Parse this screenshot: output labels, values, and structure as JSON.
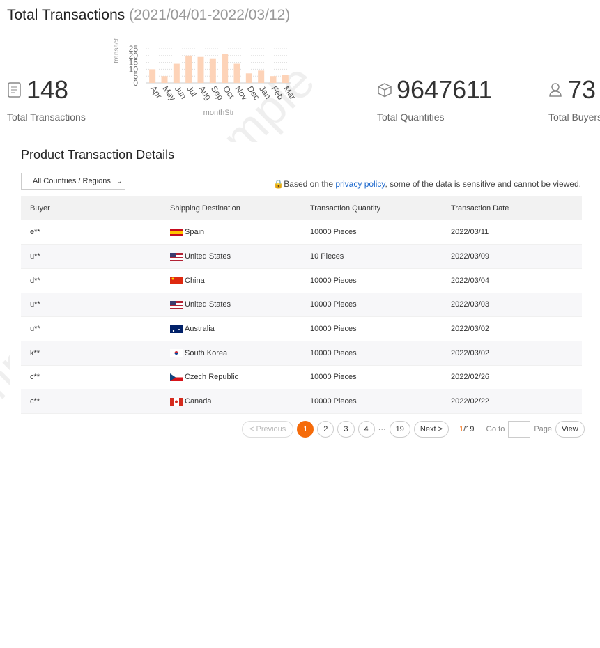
{
  "header": {
    "title": "Total Transactions",
    "date_range": "(2021/04/01-2022/03/12)"
  },
  "stats": [
    {
      "value": "148",
      "label": "Total Transactions",
      "icon": "document-icon"
    },
    {
      "value": "9647611",
      "label": "Total Quantities",
      "icon": "box-icon"
    },
    {
      "value": "73",
      "label": "Total Buyers",
      "icon": "users-icon"
    }
  ],
  "chart_data": {
    "type": "bar",
    "categories": [
      "Apr",
      "May",
      "Jun",
      "Jul",
      "Aug",
      "Sep",
      "Oct",
      "Nov",
      "Dec",
      "Jan",
      "Feb",
      "Mar"
    ],
    "values": [
      10,
      5,
      14,
      20,
      19,
      18,
      21,
      14,
      7,
      9,
      5,
      6
    ],
    "xlabel": "monthStr",
    "ylabel": "transact",
    "ylim": [
      0,
      25
    ],
    "yticks": [
      0,
      5,
      10,
      15,
      20,
      25
    ],
    "color": "#fdd3b8"
  },
  "details": {
    "title": "Product Transaction Details",
    "filter": "All Countries / Regions",
    "privacy_pre": "Based on the ",
    "privacy_link": "privacy policy",
    "privacy_post": ", some of the data is sensitive and cannot be viewed.",
    "columns": [
      "Buyer",
      "Shipping Destination",
      "Transaction Quantity",
      "Transaction Date"
    ],
    "rows": [
      {
        "buyer": "e**",
        "dest": "Spain",
        "flag": "es",
        "qty": "10000 Pieces",
        "date": "2022/03/11"
      },
      {
        "buyer": "u**",
        "dest": "United States",
        "flag": "us",
        "qty": "10 Pieces",
        "date": "2022/03/09"
      },
      {
        "buyer": "d**",
        "dest": "China",
        "flag": "cn",
        "qty": "10000 Pieces",
        "date": "2022/03/04"
      },
      {
        "buyer": "u**",
        "dest": "United States",
        "flag": "us",
        "qty": "10000 Pieces",
        "date": "2022/03/03"
      },
      {
        "buyer": "u**",
        "dest": "Australia",
        "flag": "au",
        "qty": "10000 Pieces",
        "date": "2022/03/02"
      },
      {
        "buyer": "k**",
        "dest": "South Korea",
        "flag": "kr",
        "qty": "10000 Pieces",
        "date": "2022/03/02"
      },
      {
        "buyer": "c**",
        "dest": "Czech Republic",
        "flag": "cz",
        "qty": "10000 Pieces",
        "date": "2022/02/26"
      },
      {
        "buyer": "c**",
        "dest": "Canada",
        "flag": "ca",
        "qty": "10000 Pieces",
        "date": "2022/02/22"
      }
    ]
  },
  "pager": {
    "prev": "< Previous",
    "pages": [
      "1",
      "2",
      "3",
      "4"
    ],
    "ellipsis": "···",
    "last": "19",
    "next": "Next >",
    "current": "1",
    "total": "/19",
    "goto": "Go to",
    "page": "Page",
    "view": "View"
  },
  "watermark": "Sample Sample Sample"
}
